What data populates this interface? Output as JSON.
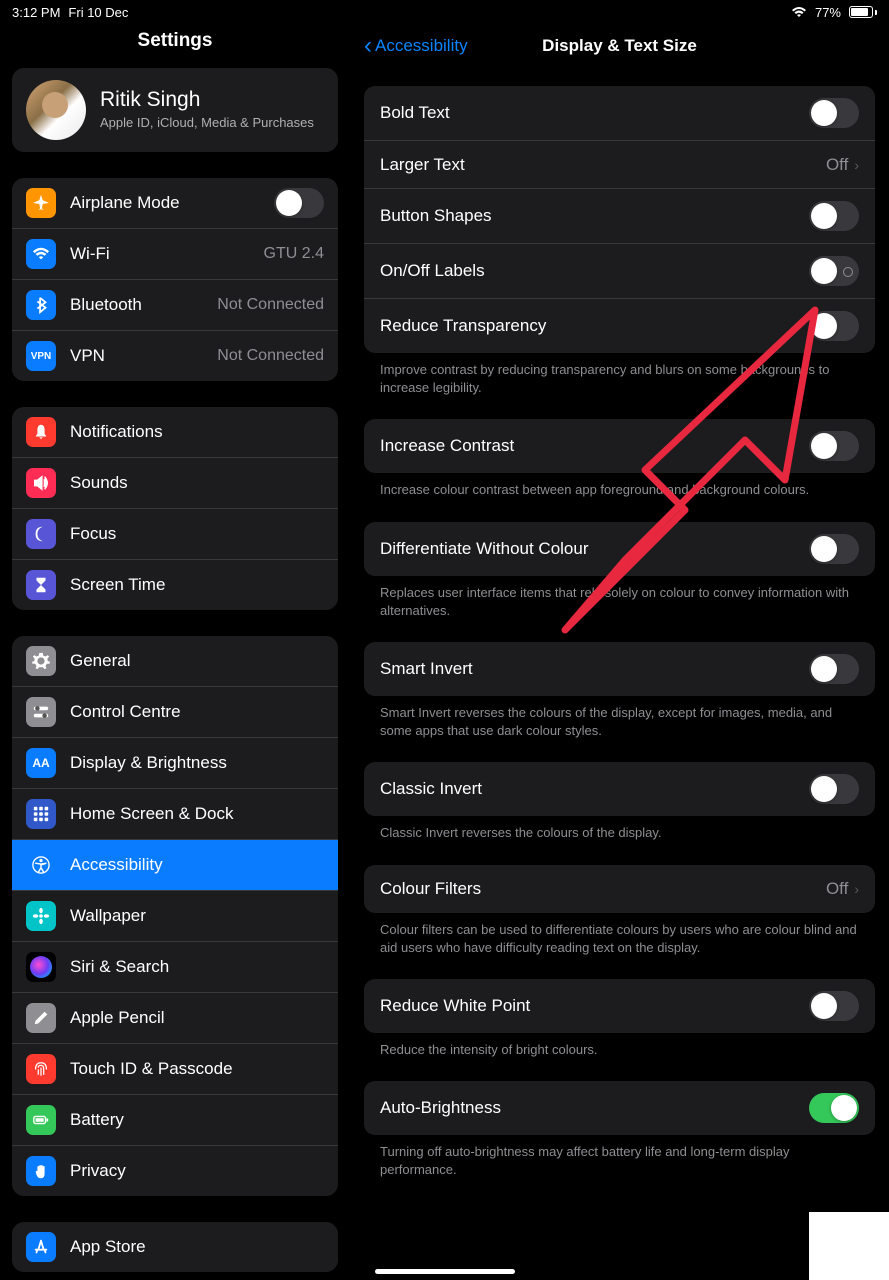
{
  "statusbar": {
    "time": "3:12 PM",
    "date": "Fri 10 Dec",
    "battery": "77%"
  },
  "sidebar": {
    "title": "Settings",
    "profile": {
      "name": "Ritik Singh",
      "sub": "Apple ID, iCloud, Media & Purchases"
    },
    "groups": [
      [
        {
          "icon": "airplane",
          "bg": "#ff9500",
          "label": "Airplane Mode",
          "type": "toggle",
          "on": false
        },
        {
          "icon": "wifi",
          "bg": "#0a7cff",
          "label": "Wi-Fi",
          "value": "GTU 2.4"
        },
        {
          "icon": "bluetooth",
          "bg": "#0a7cff",
          "label": "Bluetooth",
          "value": "Not Connected"
        },
        {
          "icon": "vpn",
          "bg": "#0a7cff",
          "label": "VPN",
          "value": "Not Connected"
        }
      ],
      [
        {
          "icon": "bell",
          "bg": "#ff3b30",
          "label": "Notifications"
        },
        {
          "icon": "speaker",
          "bg": "#ff2d55",
          "label": "Sounds"
        },
        {
          "icon": "moon",
          "bg": "#5856d6",
          "label": "Focus"
        },
        {
          "icon": "hourglass",
          "bg": "#5856d6",
          "label": "Screen Time"
        }
      ],
      [
        {
          "icon": "gear",
          "bg": "#8e8e93",
          "label": "General"
        },
        {
          "icon": "switches",
          "bg": "#8e8e93",
          "label": "Control Centre"
        },
        {
          "icon": "aa",
          "bg": "#0a7cff",
          "label": "Display & Brightness"
        },
        {
          "icon": "grid",
          "bg": "#3058c8",
          "label": "Home Screen & Dock"
        },
        {
          "icon": "access",
          "bg": "#0a7cff",
          "label": "Accessibility",
          "selected": true
        },
        {
          "icon": "flower",
          "bg": "#00c4c8",
          "label": "Wallpaper"
        },
        {
          "icon": "siri",
          "bg": "#000",
          "label": "Siri & Search"
        },
        {
          "icon": "pencil",
          "bg": "#8e8e93",
          "label": "Apple Pencil"
        },
        {
          "icon": "touchid",
          "bg": "#ff3b30",
          "label": "Touch ID & Passcode"
        },
        {
          "icon": "battery",
          "bg": "#34c759",
          "label": "Battery"
        },
        {
          "icon": "hand",
          "bg": "#0a7cff",
          "label": "Privacy"
        }
      ],
      [
        {
          "icon": "appstore",
          "bg": "#0a7cff",
          "label": "App Store"
        }
      ]
    ]
  },
  "detail": {
    "back": "Accessibility",
    "title": "Display & Text Size",
    "sections": [
      {
        "rows": [
          {
            "label": "Bold Text",
            "type": "toggle",
            "on": false
          },
          {
            "label": "Larger Text",
            "type": "link",
            "value": "Off"
          },
          {
            "label": "Button Shapes",
            "type": "toggle",
            "on": false
          },
          {
            "label": "On/Off Labels",
            "type": "toggle-half",
            "on": false
          },
          {
            "label": "Reduce Transparency",
            "type": "toggle",
            "on": false
          }
        ],
        "footer": "Improve contrast by reducing transparency and blurs on some backgrounds to increase legibility."
      },
      {
        "rows": [
          {
            "label": "Increase Contrast",
            "type": "toggle",
            "on": false
          }
        ],
        "footer": "Increase colour contrast between app foreground and background colours."
      },
      {
        "rows": [
          {
            "label": "Differentiate Without Colour",
            "type": "toggle",
            "on": false
          }
        ],
        "footer": "Replaces user interface items that rely solely on colour to convey information with alternatives."
      },
      {
        "rows": [
          {
            "label": "Smart Invert",
            "type": "toggle",
            "on": false
          }
        ],
        "footer": "Smart Invert reverses the colours of the display, except for images, media, and some apps that use dark colour styles."
      },
      {
        "rows": [
          {
            "label": "Classic Invert",
            "type": "toggle",
            "on": false
          }
        ],
        "footer": "Classic Invert reverses the colours of the display."
      },
      {
        "rows": [
          {
            "label": "Colour Filters",
            "type": "link",
            "value": "Off"
          }
        ],
        "footer": "Colour filters can be used to differentiate colours by users who are colour blind and aid users who have difficulty reading text on the display."
      },
      {
        "rows": [
          {
            "label": "Reduce White Point",
            "type": "toggle",
            "on": false
          }
        ],
        "footer": "Reduce the intensity of bright colours."
      },
      {
        "rows": [
          {
            "label": "Auto-Brightness",
            "type": "toggle",
            "on": true
          }
        ],
        "footer": "Turning off auto-brightness may affect battery life and long-term display performance."
      }
    ]
  }
}
